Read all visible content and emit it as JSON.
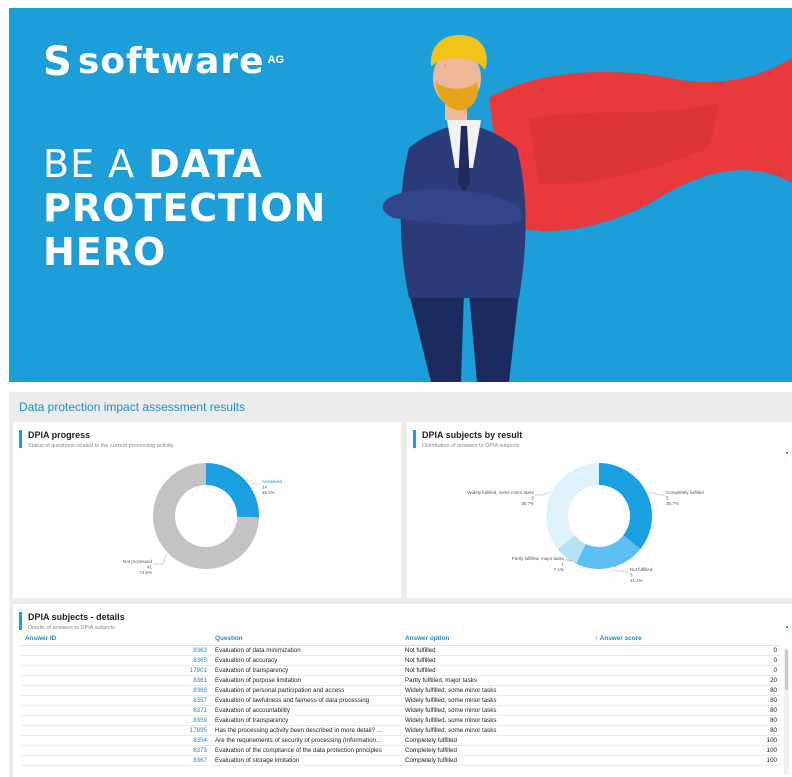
{
  "banner": {
    "logo_mark": "S",
    "logo_word": "software",
    "logo_suffix": "AG",
    "headline_line1_light": "BE A ",
    "headline_line1_bold": "DATA",
    "headline_line2": "PROTECTION",
    "headline_line3": "HERO",
    "colors": {
      "background": "#1d9ed8",
      "cape": "#e8393c",
      "suit": "#2b3a78",
      "hair": "#f2c318"
    }
  },
  "dashboard": {
    "title": "Data protection impact assessment results",
    "progress": {
      "title": "DPIA progress",
      "subtitle": "Status of questions related to the current processing activity"
    },
    "by_result": {
      "title": "DPIA subjects by result",
      "subtitle": "Distribution of answers to DPIA subjects"
    },
    "details": {
      "title": "DPIA subjects - details",
      "subtitle": "Details of answers to DPIA subjects",
      "columns": {
        "id": "Answer ID",
        "question": "Question",
        "option": "Answer option",
        "score": "↑ Answer score"
      },
      "rows": [
        {
          "id": "8363",
          "question": "Evaluation of data minimization",
          "option": "Not fulfilled",
          "score": "0"
        },
        {
          "id": "8365",
          "question": "Evaluation of accuracy",
          "option": "Not fulfilled",
          "score": "0"
        },
        {
          "id": "17901",
          "question": "Evaluation of transparency",
          "option": "Not fulfilled",
          "score": "0"
        },
        {
          "id": "8361",
          "question": "Evaluation of purpose limitation",
          "option": "Partly fulfilled, major tasks",
          "score": "20"
        },
        {
          "id": "8369",
          "question": "Evaluation of personal participation and access",
          "option": "Widely fulfilled, some minor tasks",
          "score": "80"
        },
        {
          "id": "8357",
          "question": "Evaluation of lawfulness and fairness of data processing",
          "option": "Widely fulfilled, some minor tasks",
          "score": "80"
        },
        {
          "id": "8371",
          "question": "Evaluation of accountability",
          "option": "Widely fulfilled, some minor tasks",
          "score": "80"
        },
        {
          "id": "8359",
          "question": "Evaluation of transparency",
          "option": "Widely fulfilled, some minor tasks",
          "score": "80"
        },
        {
          "id": "17895",
          "question": "Has the processing activity been described in more detail? ...",
          "option": "Widely fulfilled, some minor tasks",
          "score": "80"
        },
        {
          "id": "8354",
          "question": "Are the requirements of security of processing (Information...",
          "option": "Completely fulfilled",
          "score": "100"
        },
        {
          "id": "8373",
          "question": "Evaluation of the compliance of the data protection principles",
          "option": "Completely fulfilled",
          "score": "100"
        },
        {
          "id": "8367",
          "question": "Evaluation of storage limitation",
          "option": "Completely fulfilled",
          "score": "100"
        }
      ]
    }
  },
  "chart_data": [
    {
      "type": "pie",
      "title": "DPIA progress",
      "categories": [
        "Answered",
        "Not processed"
      ],
      "values": [
        14,
        41
      ],
      "percent_labels": [
        "25.5%",
        "74.5%"
      ],
      "colors": [
        "#1a9fe0",
        "#c3c3c3"
      ]
    },
    {
      "type": "pie",
      "title": "DPIA subjects by result",
      "categories": [
        "Completely fulfilled",
        "Not fulfilled",
        "Partly fulfilled, major tasks",
        "Widely fulfilled, some minor tasks"
      ],
      "values": [
        5,
        3,
        1,
        5
      ],
      "percent_labels": [
        "35.7%",
        "21.4%",
        "7.1%",
        "35.7%"
      ],
      "colors": [
        "#1a9fe0",
        "#5cc0f0",
        "#b6e2f8",
        "#dff2fc"
      ]
    }
  ]
}
